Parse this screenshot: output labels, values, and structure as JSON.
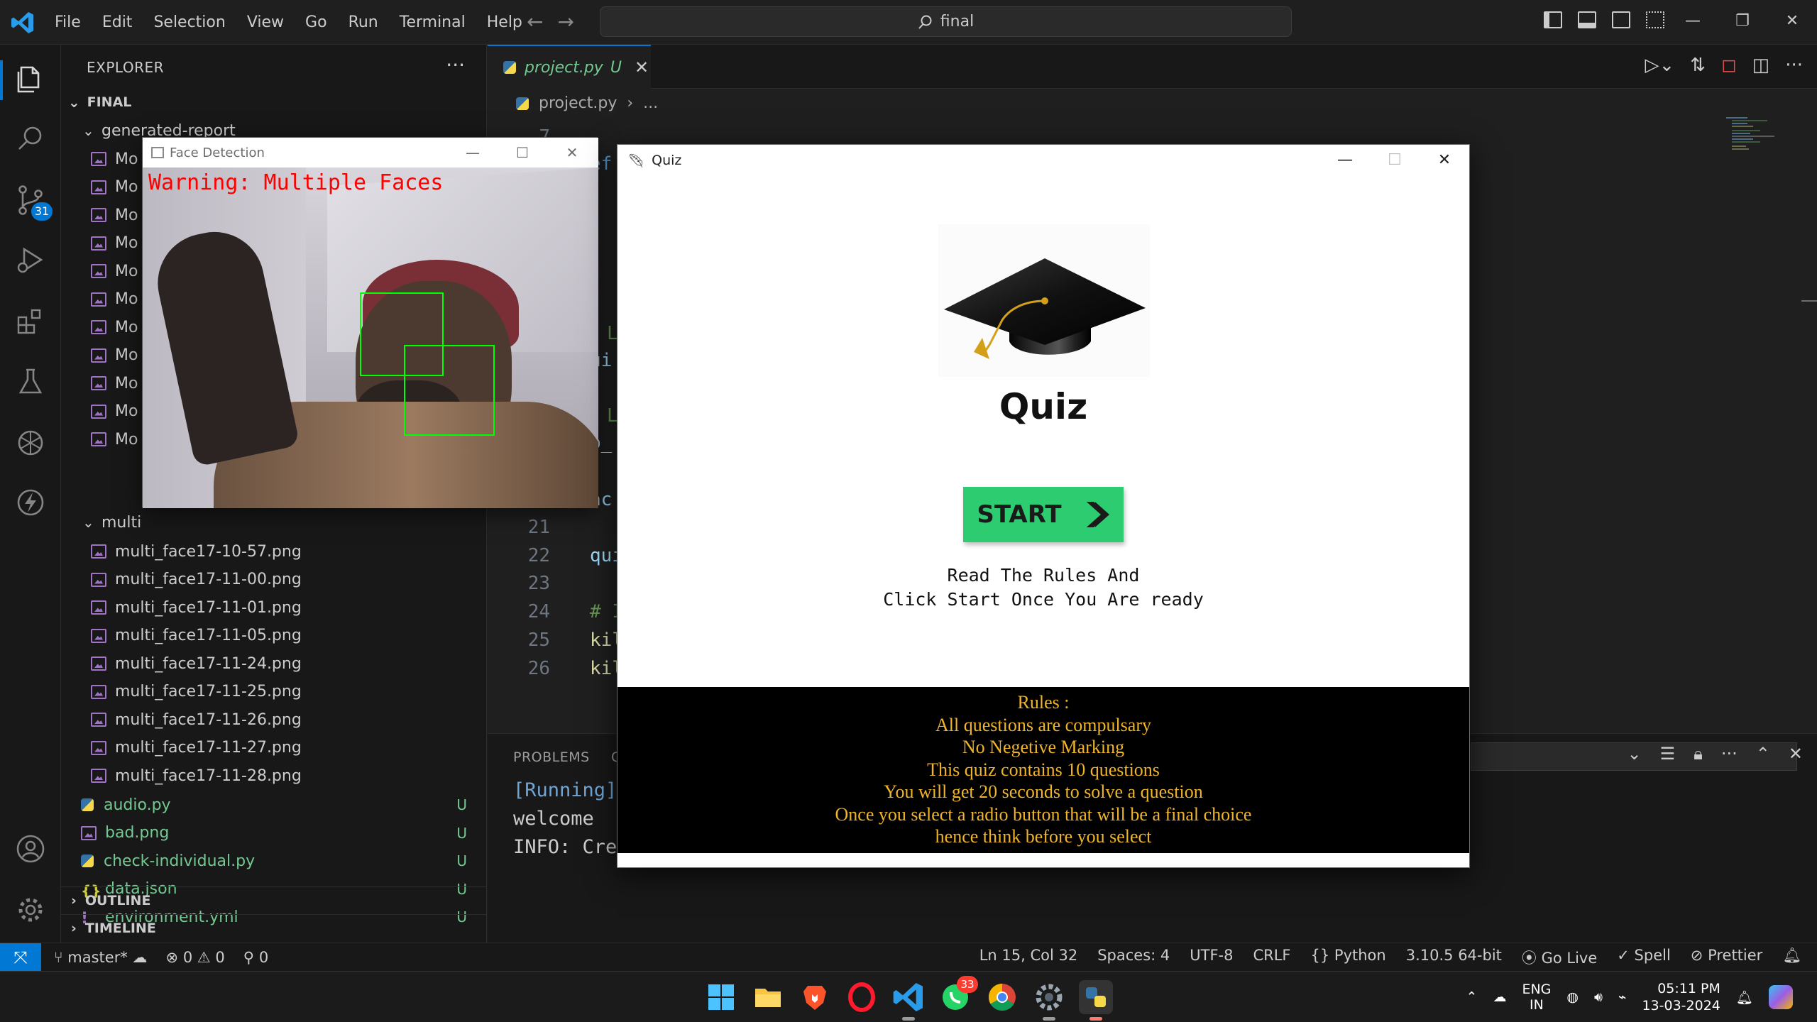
{
  "titlebar": {
    "menus": [
      "File",
      "Edit",
      "Selection",
      "View",
      "Go",
      "Run",
      "Terminal",
      "Help"
    ],
    "search": "final",
    "window_controls": [
      "—",
      "❐",
      "✕"
    ]
  },
  "activity": {
    "scm_badge": "31"
  },
  "explorer": {
    "header": "EXPLORER",
    "more": "···",
    "root": "FINAL",
    "folder_report": "generated-report",
    "report_file_prefix": "Mo",
    "folder_multi": "multi",
    "multi_files": [
      "multi_face17-10-57.png",
      "multi_face17-11-00.png",
      "multi_face17-11-01.png",
      "multi_face17-11-05.png",
      "multi_face17-11-24.png",
      "multi_face17-11-25.png",
      "multi_face17-11-26.png",
      "multi_face17-11-27.png",
      "multi_face17-11-28.png"
    ],
    "root_files": [
      {
        "name": "audio.py",
        "status": "U"
      },
      {
        "name": "bad.png",
        "status": "U"
      },
      {
        "name": "check-individual.py",
        "status": "U"
      },
      {
        "name": "data.json",
        "status": "U"
      },
      {
        "name": "environment.yml",
        "status": "U"
      }
    ],
    "outline": "OUTLINE",
    "timeline": "TIMELINE"
  },
  "editor": {
    "tab_name": "project.py",
    "tab_flag": "U",
    "breadcrumb_file": "project.py",
    "breadcrumb_rest": "...",
    "partial_lines": [
      {
        "ln": "7",
        "text": ""
      },
      {
        "ln": "",
        "text": "ef"
      },
      {
        "ln": "",
        "text": "L",
        "kind": "cm"
      },
      {
        "ln": "",
        "text": "ui"
      },
      {
        "ln": "",
        "text": "L",
        "kind": "cm"
      },
      {
        "ln": "",
        "text": "p_"
      },
      {
        "ln": "",
        "text": "ac"
      }
    ],
    "lines": [
      {
        "ln": "21",
        "text": "",
        "kind": ""
      },
      {
        "ln": "22",
        "text": "qui",
        "kind": ""
      },
      {
        "ln": "23",
        "text": "",
        "kind": ""
      },
      {
        "ln": "24",
        "text": "# I",
        "kind": "cm"
      },
      {
        "ln": "25",
        "text": "kil",
        "kind": "fn"
      },
      {
        "ln": "26",
        "text": "kil",
        "kind": "fn"
      }
    ]
  },
  "panel": {
    "tab": "PROBLEMS",
    "tab2": "C",
    "terminal_lines": [
      "[Running]",
      "welcome",
      "INFO: Cre"
    ]
  },
  "statusbar": {
    "branch": "master*",
    "errors": "0",
    "warnings": "0",
    "ports": "0",
    "position": "Ln 15, Col 32",
    "spaces": "Spaces: 4",
    "encoding": "UTF-8",
    "eol": "CRLF",
    "language": "Python",
    "interpreter": "3.10.5 64-bit",
    "golive": "Go Live",
    "spell": "Spell",
    "prettier": "Prettier"
  },
  "taskbar": {
    "whatsapp_badge": "33",
    "lang": "ENG",
    "region": "IN",
    "time": "05:11 PM",
    "date": "13-03-2024"
  },
  "face_window": {
    "title": "Face Detection",
    "warning": "Warning: Multiple Faces"
  },
  "quiz_window": {
    "title": "Quiz",
    "heading": "Quiz",
    "start_label": "START",
    "instruction_1": "Read The Rules And",
    "instruction_2": "Click Start Once You Are ready",
    "rules_title": "Rules :",
    "rules": [
      "All questions are compulsary",
      "No Negetive Marking",
      "This quiz contains 10 questions",
      "You will get 20 seconds to solve a question",
      "Once you select a radio button that will be a final choice",
      "hence think before you select"
    ]
  }
}
